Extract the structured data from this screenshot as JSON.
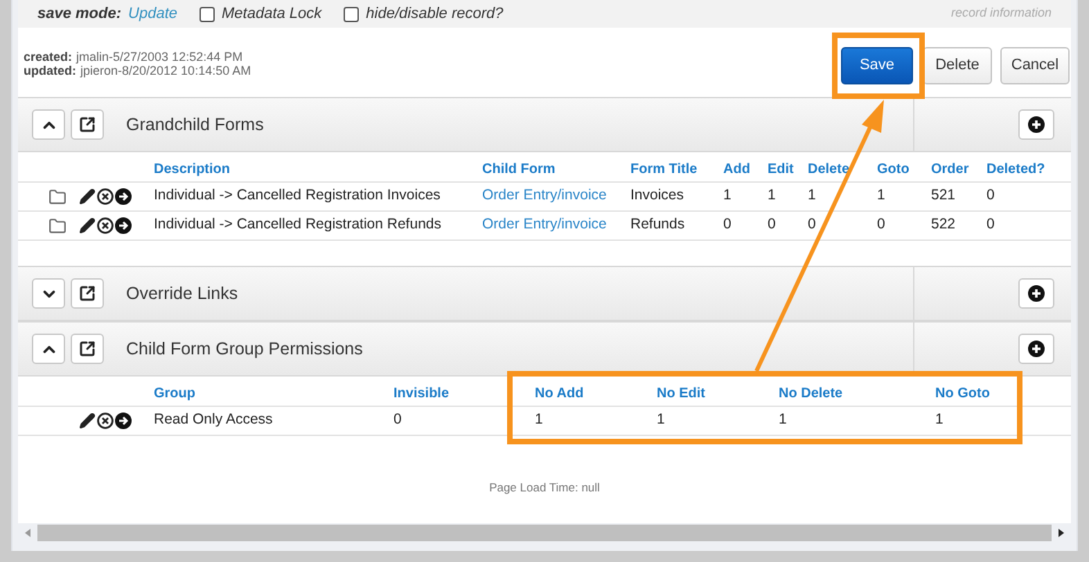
{
  "header": {
    "save_mode_label": "save mode:",
    "save_mode": "Update",
    "checkboxes": [
      {
        "label": "Metadata Lock",
        "checked": false
      },
      {
        "label": "hide/disable record?",
        "checked": false
      }
    ],
    "record_information": "record information"
  },
  "audit": [
    {
      "label": "created:",
      "value": "jmalin-5/27/2003 12:52:44 PM"
    },
    {
      "label": "updated:",
      "value": "jpieron-8/20/2012 10:14:50 AM"
    }
  ],
  "buttons": [
    {
      "label": "Save",
      "kind": "primary"
    },
    {
      "label": "Delete",
      "kind": "default"
    },
    {
      "label": "Cancel",
      "kind": "default"
    }
  ],
  "sections": [
    {
      "title": "Grandchild Forms",
      "expanded": true,
      "table": {
        "columns": [
          {
            "label": "Description",
            "kind": "text"
          },
          {
            "label": "Child Form",
            "kind": "link"
          },
          {
            "label": "Form Title",
            "kind": "text"
          },
          {
            "label": "Add",
            "kind": "text"
          },
          {
            "label": "Edit",
            "kind": "text"
          },
          {
            "label": "Delete",
            "kind": "text"
          },
          {
            "label": "Goto",
            "kind": "text"
          },
          {
            "label": "Order",
            "kind": "text"
          },
          {
            "label": "Deleted?",
            "kind": "text"
          }
        ],
        "rows": [
          {
            "folder": true,
            "cells": [
              "Individual -> Cancelled Registration Invoices",
              "Order Entry/invoice",
              "Invoices",
              "1",
              "1",
              "1",
              "1",
              "521",
              "0"
            ]
          },
          {
            "folder": true,
            "cells": [
              "Individual -> Cancelled Registration Refunds",
              "Order Entry/invoice",
              "Refunds",
              "0",
              "0",
              "0",
              "0",
              "522",
              "0"
            ]
          }
        ]
      }
    },
    {
      "title": "Override Links",
      "expanded": false
    },
    {
      "title": "Child Form Group Permissions",
      "expanded": true,
      "table": {
        "columns": [
          {
            "label": "Group",
            "kind": "text"
          },
          {
            "label": "Invisible",
            "kind": "text"
          },
          {
            "label": "No Add",
            "kind": "text"
          },
          {
            "label": "No Edit",
            "kind": "text"
          },
          {
            "label": "No Delete",
            "kind": "text"
          },
          {
            "label": "No Goto",
            "kind": "text"
          }
        ],
        "rows": [
          {
            "folder": false,
            "cells": [
              "Read Only Access",
              "0",
              "1",
              "1",
              "1",
              "1"
            ]
          }
        ]
      }
    }
  ],
  "footer": "Page Load Time: null"
}
